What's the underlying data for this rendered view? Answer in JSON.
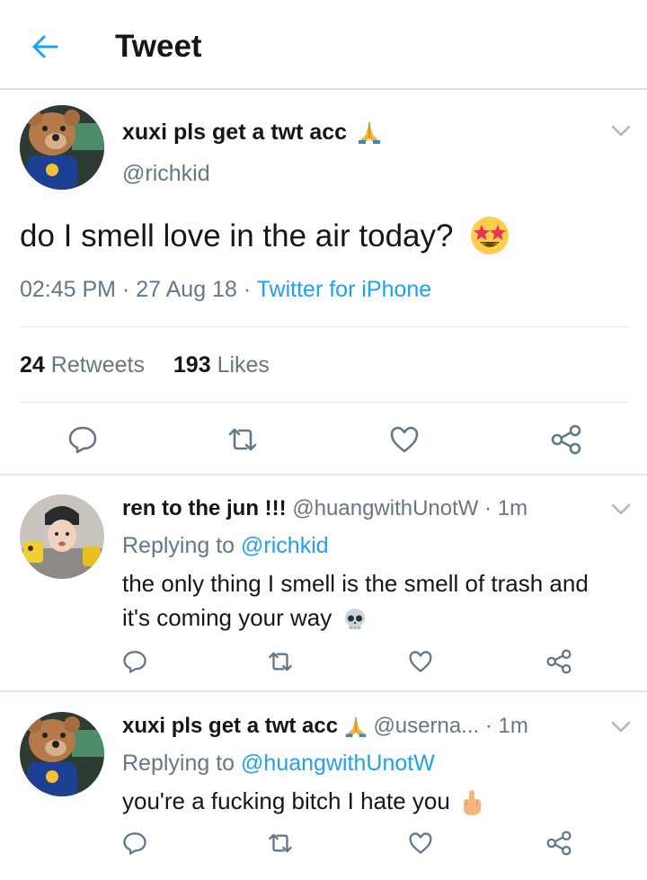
{
  "header": {
    "title": "Tweet"
  },
  "main_tweet": {
    "display_name": "xuxi pls get a twt acc",
    "handle": "@richkid",
    "text": "do I smell love in the air today?",
    "time": "02:45 PM",
    "date": "27 Aug 18",
    "source": "Twitter for iPhone",
    "retweets_count": "24",
    "retweets_label": "Retweets",
    "likes_count": "193",
    "likes_label": "Likes"
  },
  "replies": [
    {
      "display_name": "ren to the jun !!!",
      "handle": "@huangwithUnotW",
      "time": "1m",
      "replying_label": "Replying to",
      "replying_to": "@richkid",
      "text": "the only thing I smell is the smell of trash and it's coming your way"
    },
    {
      "display_name": "xuxi pls get a twt acc",
      "handle": "@userna...",
      "time": "1m",
      "replying_label": "Replying to",
      "replying_to": "@huangwithUnotW",
      "text": "you're a fucking bitch I hate you"
    }
  ],
  "colors": {
    "accent": "#1da1f2",
    "muted": "#657786",
    "text": "#14171a",
    "divider": "#e1e8ed"
  },
  "icons": [
    "back-arrow-icon",
    "chevron-down-icon",
    "reply-icon",
    "retweet-icon",
    "like-icon",
    "share-icon",
    "folded-hands-emoji",
    "star-struck-emoji",
    "skull-emoji",
    "middle-finger-emoji"
  ]
}
